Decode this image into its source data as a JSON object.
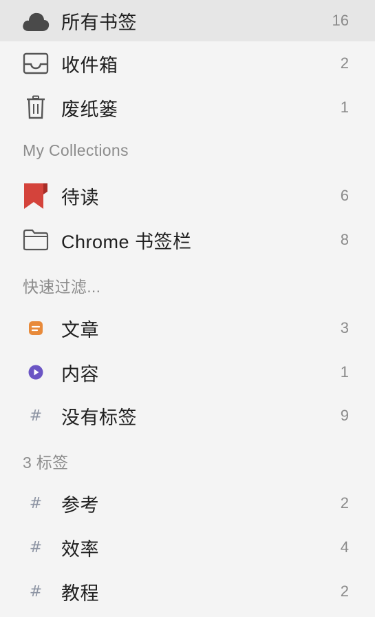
{
  "main_items": [
    {
      "label": "所有书签",
      "count": "16",
      "icon": "cloud-icon"
    },
    {
      "label": "收件箱",
      "count": "2",
      "icon": "inbox-icon"
    },
    {
      "label": "废纸篓",
      "count": "1",
      "icon": "trash-icon"
    }
  ],
  "collections_header": "My Collections",
  "collections": [
    {
      "label": "待读",
      "count": "6",
      "icon": "bookmark-icon"
    },
    {
      "label": "Chrome 书签栏",
      "count": "8",
      "icon": "folder-icon"
    }
  ],
  "filters_header": "快速过滤...",
  "filters": [
    {
      "label": "文章",
      "count": "3",
      "icon": "article-icon"
    },
    {
      "label": "内容",
      "count": "1",
      "icon": "play-icon"
    },
    {
      "label": "没有标签",
      "count": "9",
      "icon": "hash-icon"
    }
  ],
  "tags_header": "3 标签",
  "tags": [
    {
      "label": "参考",
      "count": "2",
      "icon": "hash-icon"
    },
    {
      "label": "效率",
      "count": "4",
      "icon": "hash-icon"
    },
    {
      "label": "教程",
      "count": "2",
      "icon": "hash-icon"
    }
  ],
  "colors": {
    "selected_bg": "#e6e6e6",
    "bookmark_red": "#d4433b",
    "article_orange": "#e88a3a",
    "play_purple": "#6b55c4",
    "hash_gray": "#8d94a3"
  }
}
